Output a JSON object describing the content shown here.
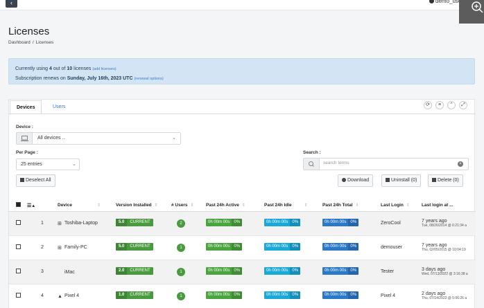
{
  "topbar": {
    "back_icon": "‹",
    "user": "demo_user"
  },
  "page": {
    "title": "Licenses",
    "breadcrumb": [
      "Dashboard",
      "Licenses"
    ]
  },
  "alert": {
    "line1_prefix": "Currently using ",
    "used": "4",
    "line1_mid": " out of ",
    "total": "10",
    "line1_suffix": " licenses",
    "add_link": "(add licenses)",
    "line2_prefix": "Subscription renews on ",
    "renew_date": "Sunday, July 16th, 2023 UTC",
    "renewal_link": "(renewal options)"
  },
  "tabs": [
    "Devices",
    "Users"
  ],
  "filters": {
    "device_label": "Device :",
    "device_value": "All devices ..",
    "perpage_label": "Per Page :",
    "perpage_value": "25 entries",
    "search_label": "Search :",
    "search_placeholder": "search terms"
  },
  "buttons": {
    "deselect": "Deselect All",
    "download": "Download",
    "uninstall": "Uninstall (0)",
    "delete": "Delete (0)"
  },
  "table": {
    "columns": [
      "Device",
      "Version Installed",
      "# Users",
      "Past 24h Active",
      "Past 24h Idle",
      "Past 24h Total",
      "Last Login",
      "Last login at ..."
    ],
    "rows": [
      {
        "num": "1",
        "os_icon": "windows-icon",
        "device": "Toshiba-Laptop",
        "version": "5.0",
        "status": "CURRENT",
        "users": "2",
        "active_time": "0h 00m 00s",
        "active_pct": "0%",
        "idle_time": "0h 00m 00s",
        "idle_pct": "0%",
        "total_time": "0h 00m 00s",
        "total_pct": "0%",
        "last_login": "ZeroCool",
        "ago": "7 years ago",
        "date": "Tue, 08/26/2014 @ 6:21:34 a"
      },
      {
        "num": "2",
        "os_icon": "windows-icon",
        "device": "Family-PC",
        "version": "5.0",
        "status": "CURRENT",
        "users": "1",
        "active_time": "0h 00m 00s",
        "active_pct": "0%",
        "idle_time": "0h 00m 00s",
        "idle_pct": "0%",
        "total_time": "0h 00m 00s",
        "total_pct": "0%",
        "last_login": "demouser",
        "ago": "7 years ago",
        "date": "Thu, 02/05/2015 @ 10:04:19"
      },
      {
        "num": "3",
        "os_icon": "apple-icon",
        "device": "iMac",
        "version": "2.0",
        "status": "CURRENT",
        "users": "1",
        "active_time": "0h 00m 00s",
        "active_pct": "0%",
        "idle_time": "0h 00m 00s",
        "idle_pct": "0%",
        "total_time": "0h 00m 00s",
        "total_pct": "0%",
        "last_login": "Tester",
        "ago": "3 days ago",
        "date": "Wed, 07/13/2022 @ 3:16:38 a"
      },
      {
        "num": "4",
        "os_icon": "android-icon",
        "device": "Pixel 4",
        "version": "1.0",
        "status": "CURRENT",
        "users": "1",
        "active_time": "0h 00m 00s",
        "active_pct": "0%",
        "idle_time": "0h 00m 00s",
        "idle_pct": "0%",
        "total_time": "0h 00m 00s",
        "total_pct": "0%",
        "last_login": "Pixel 4",
        "ago": "2 days ago",
        "date": "Thu, 07/14/2022 @ 5:06:26 a"
      }
    ]
  }
}
